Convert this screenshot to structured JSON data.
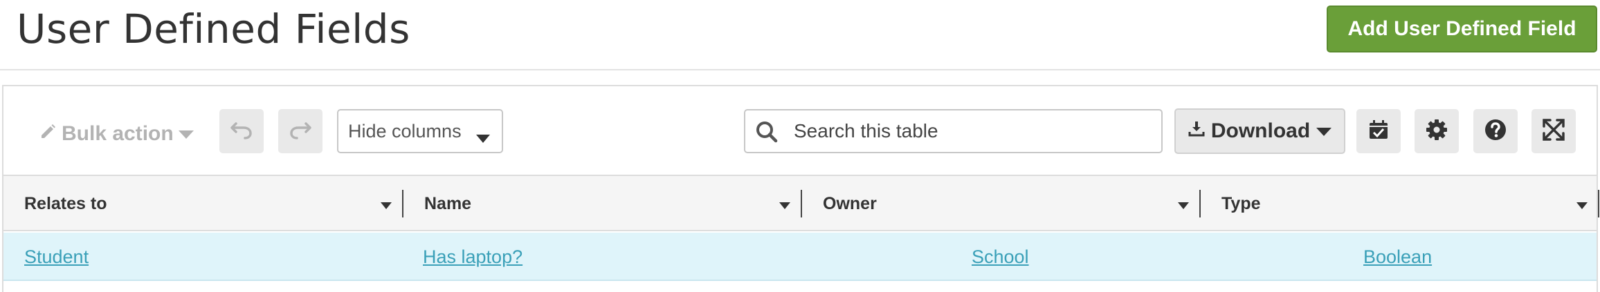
{
  "header": {
    "title": "User Defined Fields",
    "add_button_label": "Add User Defined Field"
  },
  "toolbar": {
    "bulk_action_label": "Bulk action",
    "hide_columns_label": "Hide columns",
    "search_placeholder": "Search this table",
    "download_label": "Download"
  },
  "table": {
    "columns": [
      "Relates to",
      "Name",
      "Owner",
      "Type"
    ],
    "rows": [
      [
        "Student",
        "Has laptop?",
        "School",
        "Boolean"
      ]
    ]
  },
  "colors": {
    "accent_green": "#6a9f39",
    "link": "#3aa0b8",
    "row_highlight": "#dff4fa"
  }
}
